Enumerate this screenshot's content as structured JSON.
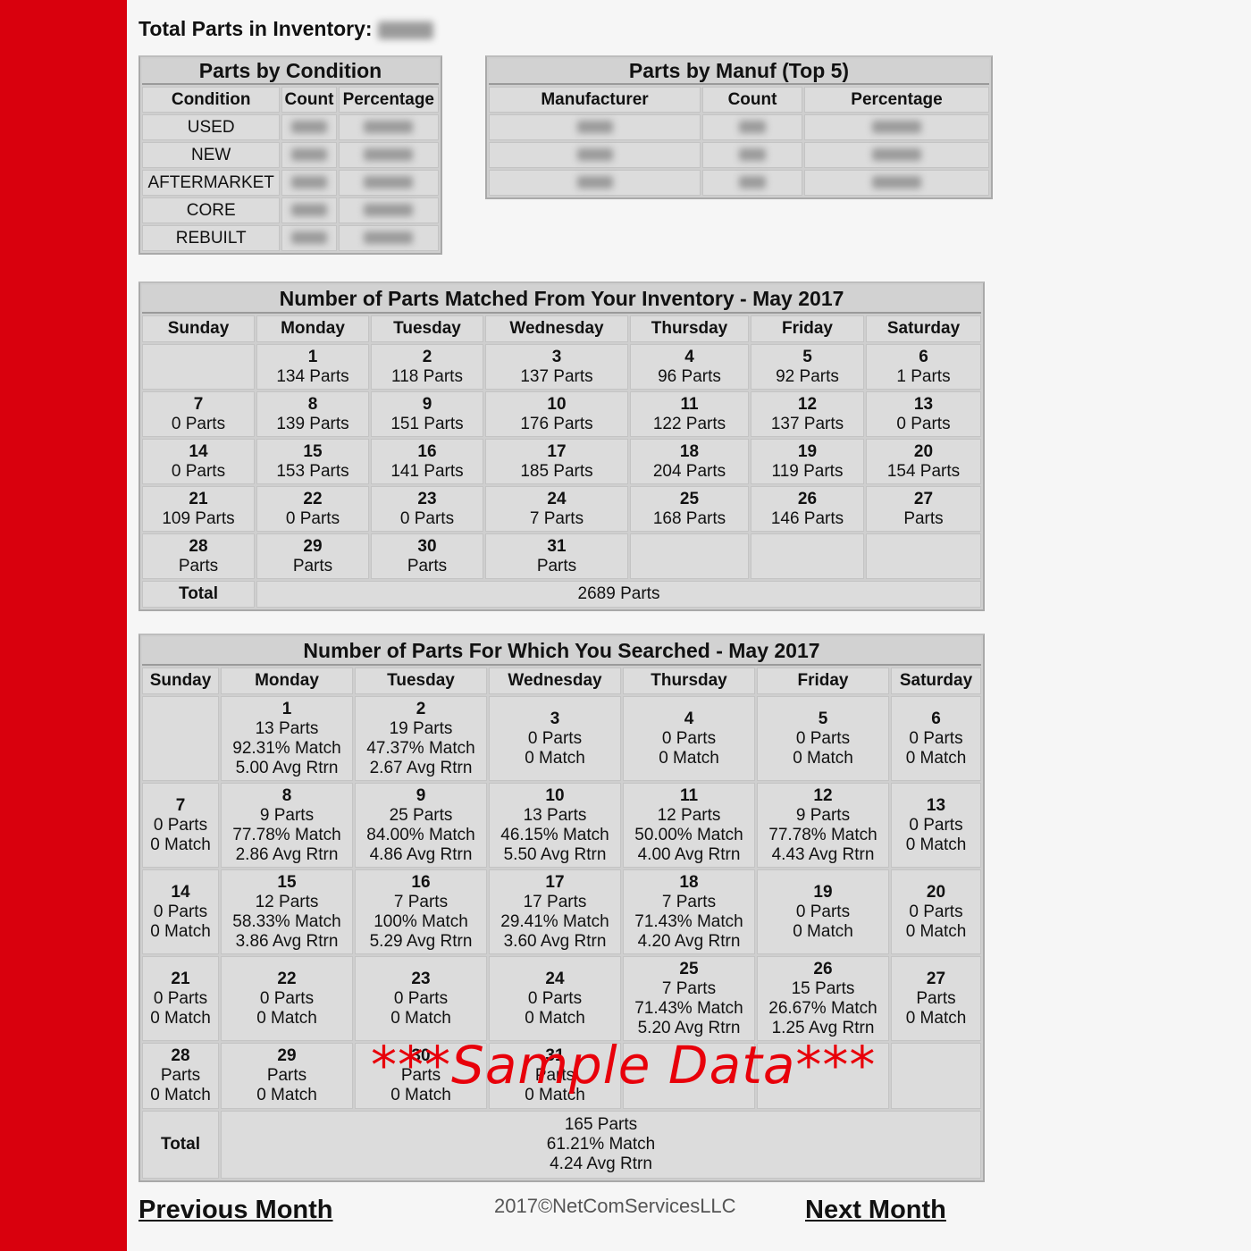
{
  "inventory": {
    "label": "Total Parts in Inventory:"
  },
  "condition_table": {
    "title": "Parts by Condition",
    "headers": [
      "Condition",
      "Count",
      "Percentage"
    ],
    "rows": [
      "USED",
      "NEW",
      "AFTERMARKET",
      "CORE",
      "REBUILT"
    ]
  },
  "manuf_table": {
    "title": "Parts by Manuf (Top 5)",
    "headers": [
      "Manufacturer",
      "Count",
      "Percentage"
    ],
    "row_count": 3
  },
  "matched": {
    "title": "Number of Parts Matched From Your Inventory - May 2017",
    "days": [
      "Sunday",
      "Monday",
      "Tuesday",
      "Wednesday",
      "Thursday",
      "Friday",
      "Saturday"
    ],
    "weeks": [
      [
        null,
        {
          "d": "1",
          "l": [
            "134 Parts"
          ]
        },
        {
          "d": "2",
          "l": [
            "118 Parts"
          ]
        },
        {
          "d": "3",
          "l": [
            "137 Parts"
          ]
        },
        {
          "d": "4",
          "l": [
            "96 Parts"
          ]
        },
        {
          "d": "5",
          "l": [
            "92 Parts"
          ]
        },
        {
          "d": "6",
          "l": [
            "1 Parts"
          ]
        }
      ],
      [
        {
          "d": "7",
          "l": [
            "0 Parts"
          ]
        },
        {
          "d": "8",
          "l": [
            "139 Parts"
          ]
        },
        {
          "d": "9",
          "l": [
            "151 Parts"
          ]
        },
        {
          "d": "10",
          "l": [
            "176 Parts"
          ]
        },
        {
          "d": "11",
          "l": [
            "122 Parts"
          ]
        },
        {
          "d": "12",
          "l": [
            "137 Parts"
          ]
        },
        {
          "d": "13",
          "l": [
            "0 Parts"
          ]
        }
      ],
      [
        {
          "d": "14",
          "l": [
            "0 Parts"
          ]
        },
        {
          "d": "15",
          "l": [
            "153 Parts"
          ]
        },
        {
          "d": "16",
          "l": [
            "141 Parts"
          ]
        },
        {
          "d": "17",
          "l": [
            "185 Parts"
          ]
        },
        {
          "d": "18",
          "l": [
            "204 Parts"
          ]
        },
        {
          "d": "19",
          "l": [
            "119 Parts"
          ]
        },
        {
          "d": "20",
          "l": [
            "154 Parts"
          ]
        }
      ],
      [
        {
          "d": "21",
          "l": [
            "109 Parts"
          ]
        },
        {
          "d": "22",
          "l": [
            "0 Parts"
          ]
        },
        {
          "d": "23",
          "l": [
            "0 Parts"
          ]
        },
        {
          "d": "24",
          "l": [
            "7 Parts"
          ]
        },
        {
          "d": "25",
          "l": [
            "168 Parts"
          ]
        },
        {
          "d": "26",
          "l": [
            "146 Parts"
          ]
        },
        {
          "d": "27",
          "l": [
            "Parts"
          ]
        }
      ],
      [
        {
          "d": "28",
          "l": [
            "Parts"
          ]
        },
        {
          "d": "29",
          "l": [
            "Parts"
          ]
        },
        {
          "d": "30",
          "l": [
            "Parts"
          ]
        },
        {
          "d": "31",
          "l": [
            "Parts"
          ]
        },
        null,
        null,
        null
      ]
    ],
    "total_label": "Total",
    "total": [
      "2689 Parts"
    ]
  },
  "searched": {
    "title": "Number of Parts For Which You Searched - May 2017",
    "days": [
      "Sunday",
      "Monday",
      "Tuesday",
      "Wednesday",
      "Thursday",
      "Friday",
      "Saturday"
    ],
    "weeks": [
      [
        null,
        {
          "d": "1",
          "l": [
            "13 Parts",
            "92.31% Match",
            "5.00 Avg Rtrn"
          ]
        },
        {
          "d": "2",
          "l": [
            "19 Parts",
            "47.37% Match",
            "2.67 Avg Rtrn"
          ]
        },
        {
          "d": "3",
          "l": [
            "0 Parts",
            "0 Match"
          ]
        },
        {
          "d": "4",
          "l": [
            "0 Parts",
            "0 Match"
          ]
        },
        {
          "d": "5",
          "l": [
            "0 Parts",
            "0 Match"
          ]
        },
        {
          "d": "6",
          "l": [
            "0 Parts",
            "0 Match"
          ]
        }
      ],
      [
        {
          "d": "7",
          "l": [
            "0 Parts",
            "0 Match"
          ]
        },
        {
          "d": "8",
          "l": [
            "9 Parts",
            "77.78% Match",
            "2.86 Avg Rtrn"
          ]
        },
        {
          "d": "9",
          "l": [
            "25 Parts",
            "84.00% Match",
            "4.86 Avg Rtrn"
          ]
        },
        {
          "d": "10",
          "l": [
            "13 Parts",
            "46.15% Match",
            "5.50 Avg Rtrn"
          ]
        },
        {
          "d": "11",
          "l": [
            "12 Parts",
            "50.00% Match",
            "4.00 Avg Rtrn"
          ]
        },
        {
          "d": "12",
          "l": [
            "9 Parts",
            "77.78% Match",
            "4.43 Avg Rtrn"
          ]
        },
        {
          "d": "13",
          "l": [
            "0 Parts",
            "0 Match"
          ]
        }
      ],
      [
        {
          "d": "14",
          "l": [
            "0 Parts",
            "0 Match"
          ]
        },
        {
          "d": "15",
          "l": [
            "12 Parts",
            "58.33% Match",
            "3.86 Avg Rtrn"
          ]
        },
        {
          "d": "16",
          "l": [
            "7 Parts",
            "100% Match",
            "5.29 Avg Rtrn"
          ]
        },
        {
          "d": "17",
          "l": [
            "17 Parts",
            "29.41% Match",
            "3.60 Avg Rtrn"
          ]
        },
        {
          "d": "18",
          "l": [
            "7 Parts",
            "71.43% Match",
            "4.20 Avg Rtrn"
          ]
        },
        {
          "d": "19",
          "l": [
            "0 Parts",
            "0 Match"
          ]
        },
        {
          "d": "20",
          "l": [
            "0 Parts",
            "0 Match"
          ]
        }
      ],
      [
        {
          "d": "21",
          "l": [
            "0 Parts",
            "0 Match"
          ]
        },
        {
          "d": "22",
          "l": [
            "0 Parts",
            "0 Match"
          ]
        },
        {
          "d": "23",
          "l": [
            "0 Parts",
            "0 Match"
          ]
        },
        {
          "d": "24",
          "l": [
            "0 Parts",
            "0 Match"
          ]
        },
        {
          "d": "25",
          "l": [
            "7 Parts",
            "71.43% Match",
            "5.20 Avg Rtrn"
          ]
        },
        {
          "d": "26",
          "l": [
            "15 Parts",
            "26.67% Match",
            "1.25 Avg Rtrn"
          ]
        },
        {
          "d": "27",
          "l": [
            "Parts",
            "0 Match"
          ]
        }
      ],
      [
        {
          "d": "28",
          "l": [
            "Parts",
            "0 Match"
          ]
        },
        {
          "d": "29",
          "l": [
            "Parts",
            "0 Match"
          ]
        },
        {
          "d": "30",
          "l": [
            "Parts",
            "0 Match"
          ]
        },
        {
          "d": "31",
          "l": [
            "Parts",
            "0 Match"
          ]
        },
        null,
        null,
        null
      ]
    ],
    "total_label": "Total",
    "total": [
      "165 Parts",
      "61.21% Match",
      "4.24 Avg Rtrn"
    ]
  },
  "watermark": "***Sample Data***",
  "footer": {
    "previous": "Previous Month",
    "copyright": "2017©NetComServicesLLC",
    "next": "Next Month"
  },
  "colors": {
    "sidebar": "#d9000d",
    "watermark": "#e8000a",
    "cell": "#dcdcdc"
  }
}
